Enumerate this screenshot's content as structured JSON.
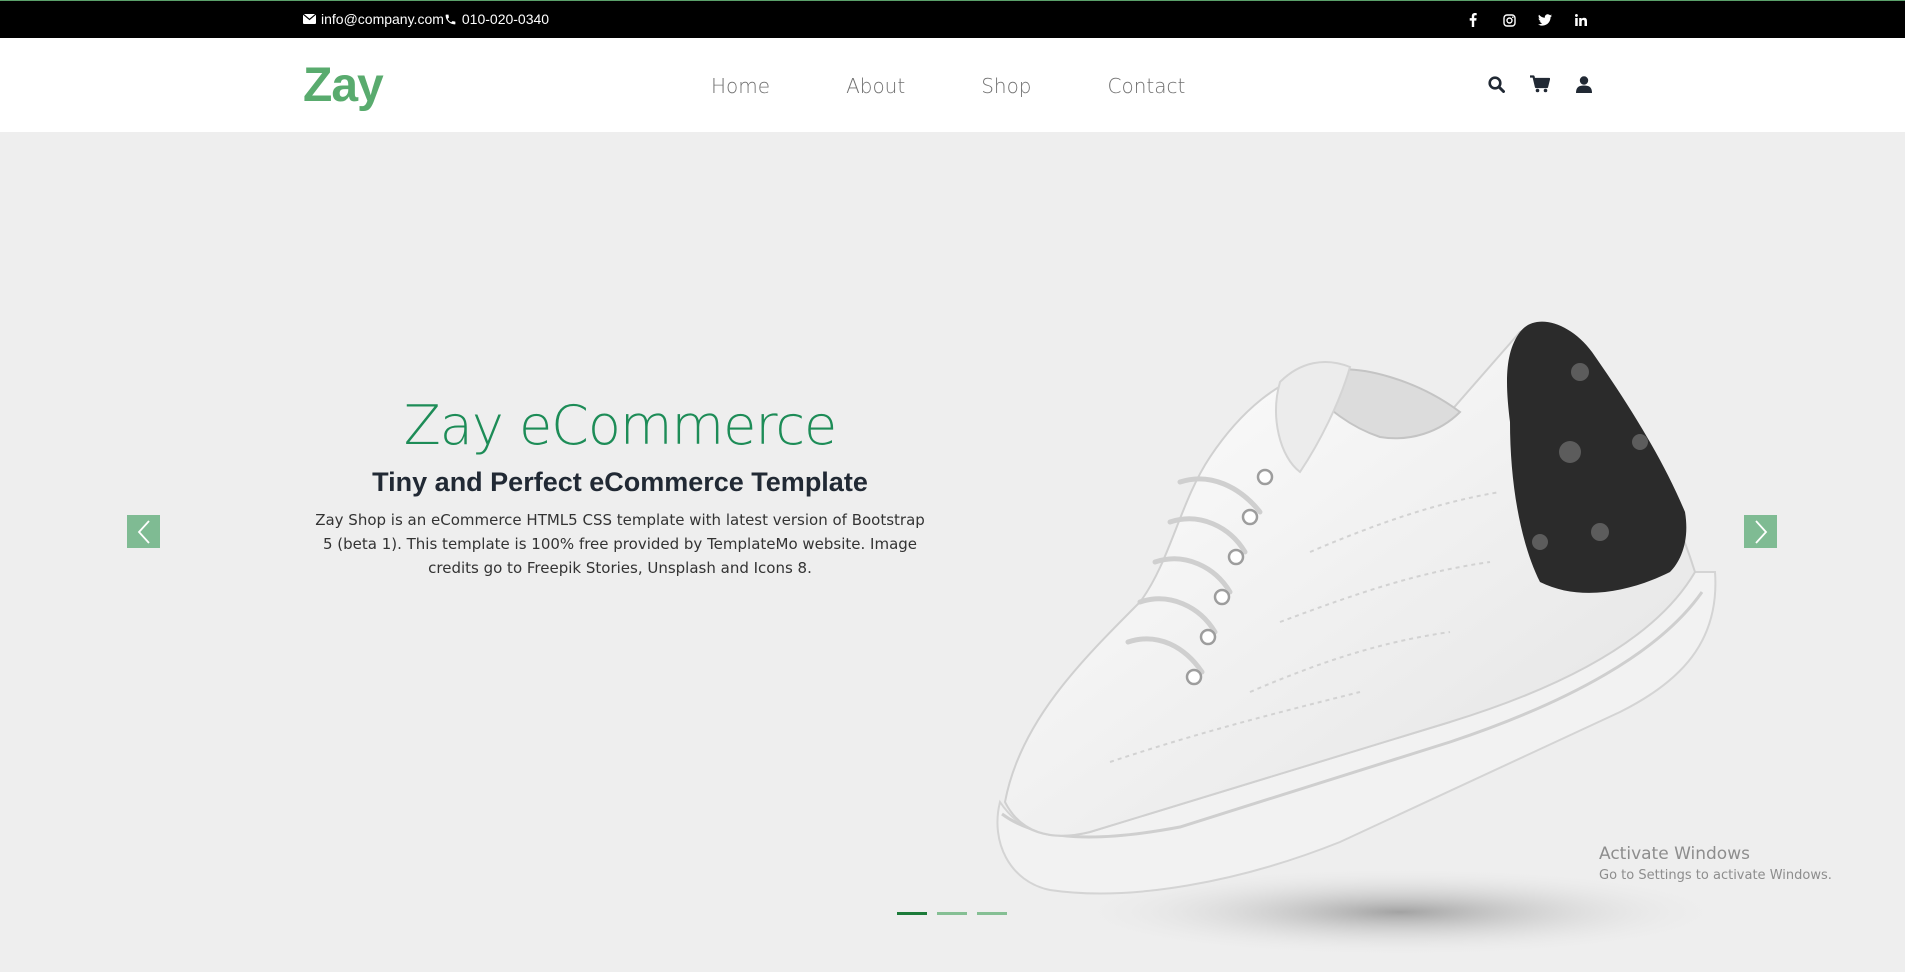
{
  "topbar": {
    "email": "info@company.com",
    "phone": "010-020-0340",
    "social": [
      "facebook-icon",
      "instagram-icon",
      "twitter-icon",
      "linkedin-icon"
    ]
  },
  "navbar": {
    "logo": "Zay",
    "links": [
      "Home",
      "About",
      "Shop",
      "Contact"
    ],
    "icons": [
      "search-icon",
      "cart-icon",
      "user-icon"
    ]
  },
  "hero": {
    "title": "Zay eCommerce",
    "subtitle": "Tiny and Perfect eCommerce Template",
    "description": "Zay Shop is an eCommerce HTML5 CSS template with latest version of Bootstrap 5 (beta 1). This template is 100% free provided by TemplateMo website. Image credits go to Freepik Stories, Unsplash and Icons 8.",
    "slides": 3,
    "active_slide": 1
  },
  "watermark": {
    "line1": "Activate Windows",
    "line2": "Go to Settings to activate Windows."
  },
  "colors": {
    "brand": "#59ab6e",
    "title_green": "#1d8c57",
    "topbar": "#000000",
    "hero_bg": "#eeeeee"
  }
}
